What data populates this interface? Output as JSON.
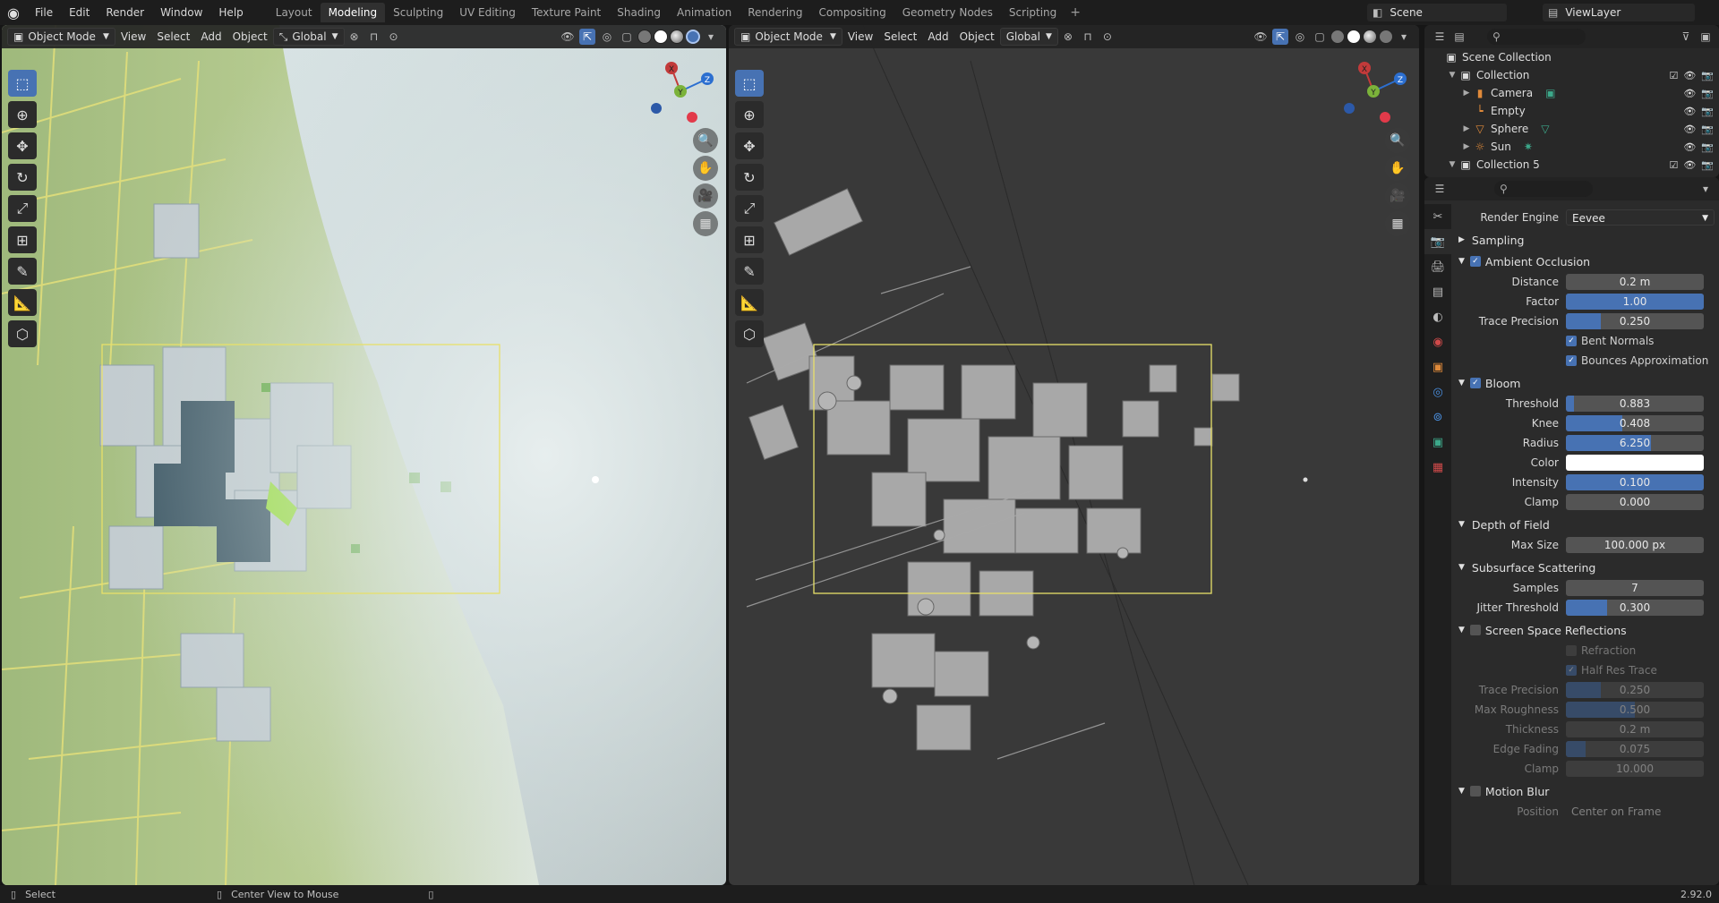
{
  "topbar": {
    "menu": [
      "File",
      "Edit",
      "Render",
      "Window",
      "Help"
    ],
    "workspaces": [
      "Layout",
      "Modeling",
      "Sculpting",
      "UV Editing",
      "Texture Paint",
      "Shading",
      "Animation",
      "Rendering",
      "Compositing",
      "Geometry Nodes",
      "Scripting"
    ],
    "active_workspace": "Modeling",
    "scene": "Scene",
    "view_layer": "ViewLayer"
  },
  "viewport_left": {
    "mode": "Object Mode",
    "menu": [
      "View",
      "Select",
      "Add",
      "Object"
    ],
    "transform_orientation": "Global"
  },
  "viewport_right": {
    "mode": "Object Mode",
    "menu": [
      "View",
      "Select",
      "Add",
      "Object"
    ],
    "transform_orientation": "Global"
  },
  "gizmo_axes": {
    "x": "X",
    "y": "Y",
    "z": "Z"
  },
  "outliner": {
    "root": "Scene Collection",
    "items": [
      {
        "label": "Collection",
        "icon": "collection-icon",
        "level": 1
      },
      {
        "label": "Camera",
        "icon": "camera-icon",
        "level": 2
      },
      {
        "label": "Empty",
        "icon": "empty-icon",
        "level": 2
      },
      {
        "label": "Sphere",
        "icon": "mesh-icon",
        "level": 2
      },
      {
        "label": "Sun",
        "icon": "light-icon",
        "level": 2
      },
      {
        "label": "Collection 5",
        "icon": "collection-icon",
        "level": 1
      }
    ]
  },
  "properties": {
    "render_engine_label": "Render Engine",
    "render_engine": "Eevee",
    "sampling": "Sampling",
    "ambient_occlusion": {
      "title": "Ambient Occlusion",
      "distance_label": "Distance",
      "distance": "0.2 m",
      "factor_label": "Factor",
      "factor": "1.00",
      "trace_precision_label": "Trace Precision",
      "trace_precision": "0.250",
      "bent_normals": "Bent Normals",
      "bounces_approx": "Bounces Approximation"
    },
    "bloom": {
      "title": "Bloom",
      "threshold_label": "Threshold",
      "threshold": "0.883",
      "knee_label": "Knee",
      "knee": "0.408",
      "radius_label": "Radius",
      "radius": "6.250",
      "color_label": "Color",
      "intensity_label": "Intensity",
      "intensity": "0.100",
      "clamp_label": "Clamp",
      "clamp": "0.000"
    },
    "dof": {
      "title": "Depth of Field",
      "max_size_label": "Max Size",
      "max_size": "100.000 px"
    },
    "sss": {
      "title": "Subsurface Scattering",
      "samples_label": "Samples",
      "samples": "7",
      "jitter_label": "Jitter Threshold",
      "jitter": "0.300"
    },
    "ssr": {
      "title": "Screen Space Reflections",
      "refraction": "Refraction",
      "half_res": "Half Res Trace",
      "trace_precision_label": "Trace Precision",
      "trace_precision": "0.250",
      "max_roughness_label": "Max Roughness",
      "max_roughness": "0.500",
      "thickness_label": "Thickness",
      "thickness": "0.2 m",
      "edge_fading_label": "Edge Fading",
      "edge_fading": "0.075",
      "clamp_label": "Clamp",
      "clamp": "10.000"
    },
    "motion_blur": {
      "title": "Motion Blur",
      "position_label": "Position",
      "position": "Center on Frame"
    }
  },
  "statusbar": {
    "left": "Select",
    "middle": "Center View to Mouse",
    "version": "2.92.0"
  }
}
